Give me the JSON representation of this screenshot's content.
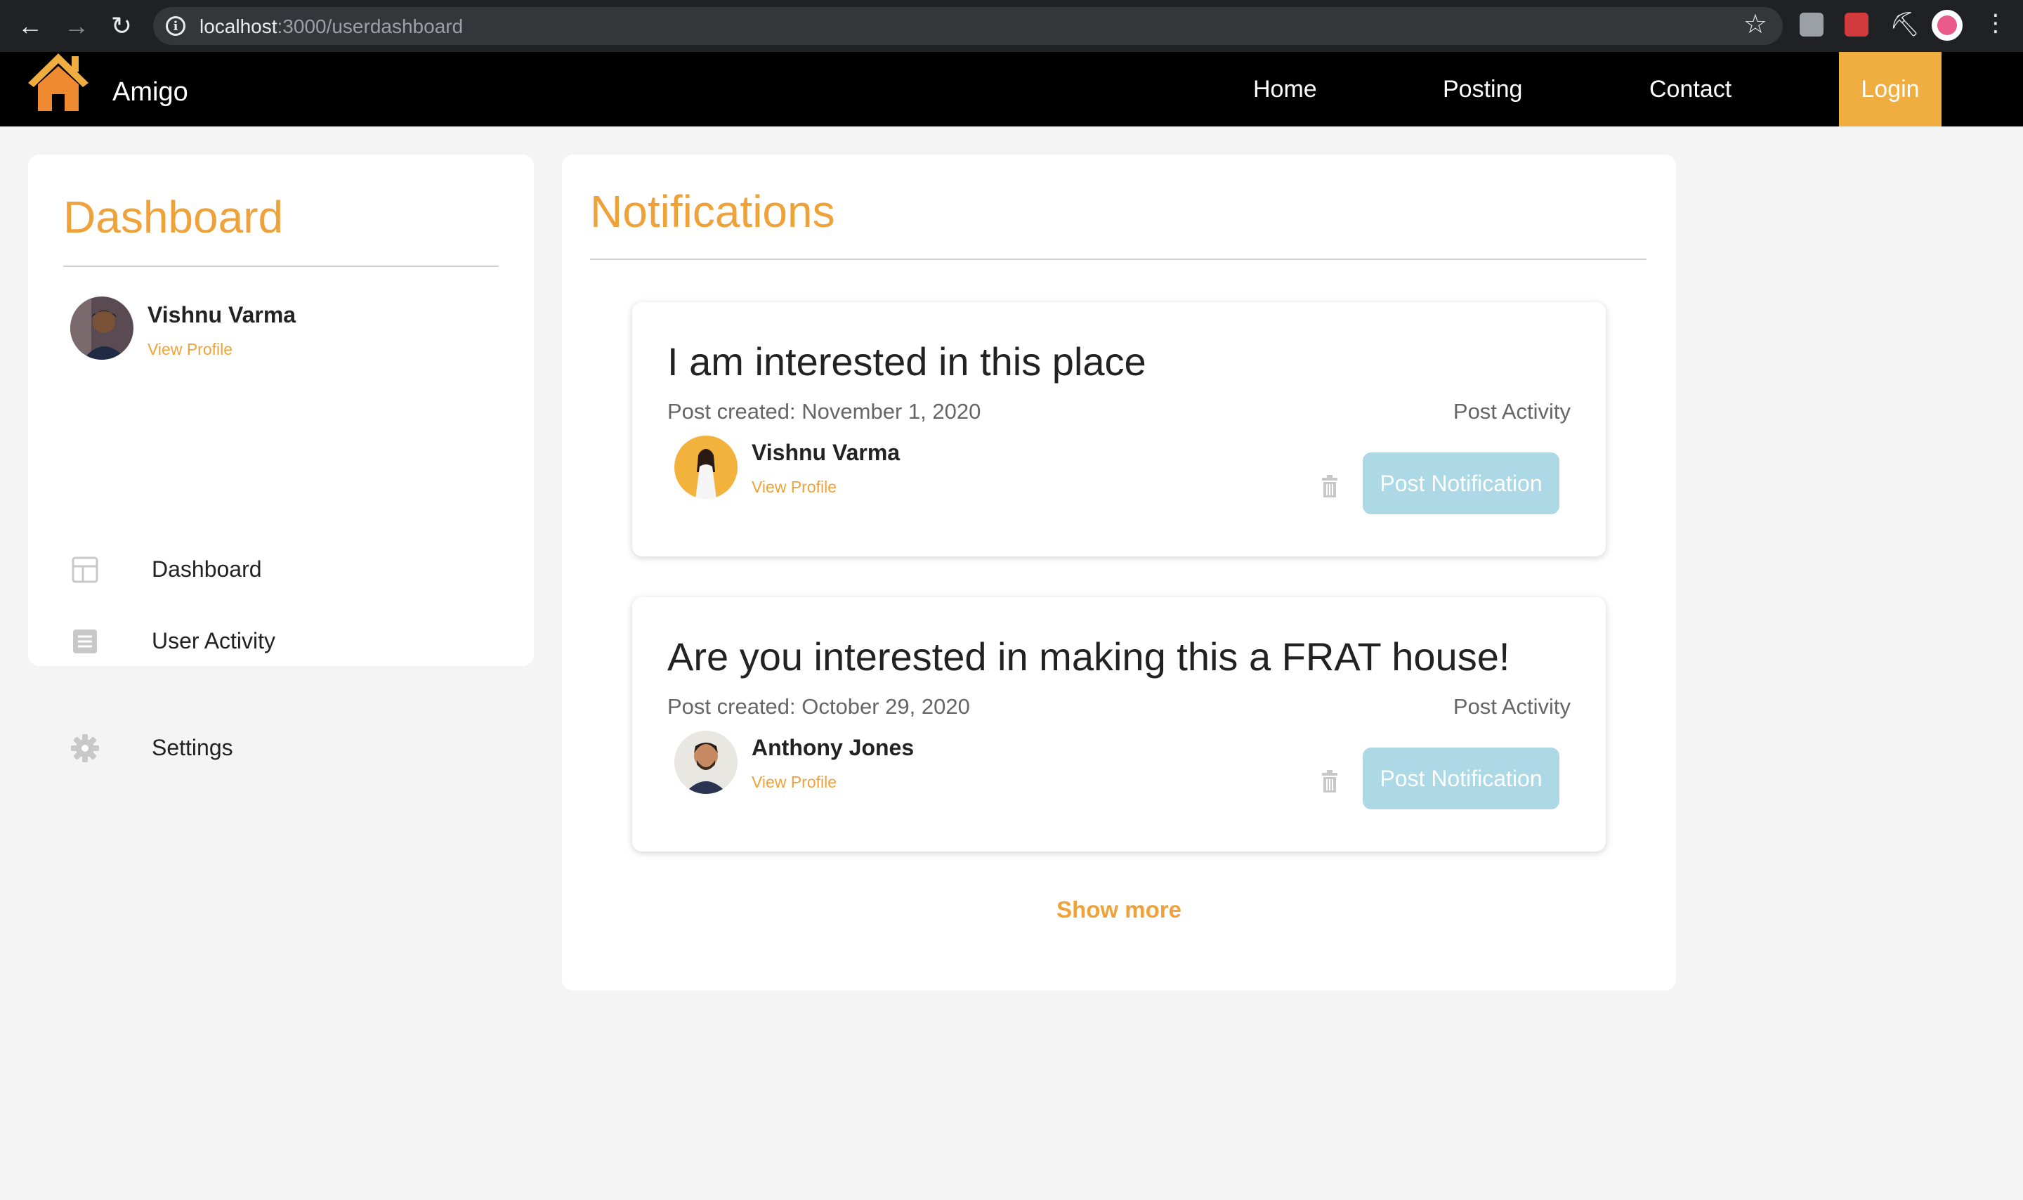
{
  "browser": {
    "url_host": "localhost",
    "url_path": ":3000/userdashboard",
    "back_icon": "arrow-left-icon",
    "forward_icon": "arrow-right-icon",
    "reload_icon": "reload-icon"
  },
  "header": {
    "brand": "Amigo",
    "nav": {
      "home": "Home",
      "posting": "Posting",
      "contact": "Contact"
    },
    "login": "Login",
    "accent": "#f0ad40"
  },
  "sidebar": {
    "title": "Dashboard",
    "user": {
      "name": "Vishnu Varma",
      "view_profile": "View Profile"
    },
    "items": [
      {
        "label": "Dashboard",
        "icon": "layout-icon"
      },
      {
        "label": "User Activity",
        "icon": "list-icon"
      },
      {
        "label": "Settings",
        "icon": "gear-icon"
      }
    ]
  },
  "notifications": {
    "title": "Notifications",
    "cards": [
      {
        "title": "I am interested in this place",
        "date": "Post created: November 1, 2020",
        "activity": "Post Activity",
        "user": "Vishnu Varma",
        "view_profile": "View Profile",
        "button": "Post Notification"
      },
      {
        "title": "Are you interested in making this a FRAT house!",
        "date": "Post created: October 29, 2020",
        "activity": "Post Activity",
        "user": "Anthony Jones",
        "view_profile": "View Profile",
        "button": "Post Notification"
      }
    ],
    "show_more": "Show more"
  },
  "colors": {
    "accent": "#f0a23a",
    "button_disabled": "#add8e6",
    "header_bg": "#000000",
    "page_bg": "#f4f4f4"
  }
}
